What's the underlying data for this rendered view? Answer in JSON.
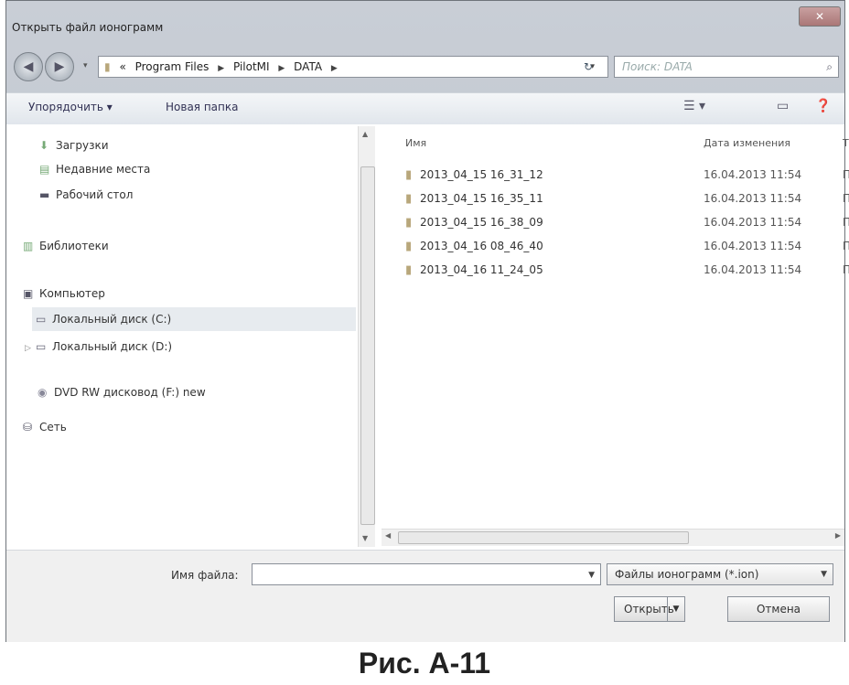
{
  "window": {
    "title": "Открыть файл ионограмм",
    "close_label": "✕"
  },
  "address": {
    "back_icon": "back-arrow-icon",
    "forward_icon": "forward-arrow-icon",
    "prefix": "«",
    "crumbs": [
      "Program Files",
      "PilotMI",
      "DATA"
    ],
    "search_placeholder": "Поиск: DATA"
  },
  "toolbar": {
    "organize_label": "Упорядочить ▾",
    "new_folder_label": "Новая папка",
    "view_icon": "view-options-icon",
    "preview_icon": "preview-pane-icon",
    "help_icon": "help-icon"
  },
  "nav": {
    "items": [
      {
        "label": "Загрузки",
        "icon": "downloads-icon"
      },
      {
        "label": "Недавние места",
        "icon": "recent-places-icon"
      },
      {
        "label": "Рабочий стол",
        "icon": "desktop-icon"
      },
      {
        "label": "Библиотеки",
        "icon": "libraries-icon"
      },
      {
        "label": "Компьютер",
        "icon": "computer-icon"
      },
      {
        "label": "Локальный диск (C:)",
        "icon": "drive-icon",
        "selected": true
      },
      {
        "label": "Локальный диск (D:)",
        "icon": "drive-icon"
      },
      {
        "label": "DVD RW дисковод (F:) new",
        "icon": "dvd-icon"
      },
      {
        "label": "Сеть",
        "icon": "network-icon"
      }
    ]
  },
  "files": {
    "columns": [
      "Имя",
      "Дата изменения",
      "Т"
    ],
    "rows": [
      {
        "name": "2013_04_15 16_31_12",
        "date": "16.04.2013 11:54",
        "extra": "П"
      },
      {
        "name": "2013_04_15 16_35_11",
        "date": "16.04.2013 11:54",
        "extra": "П"
      },
      {
        "name": "2013_04_15 16_38_09",
        "date": "16.04.2013 11:54",
        "extra": "П"
      },
      {
        "name": "2013_04_16 08_46_40",
        "date": "16.04.2013 11:54",
        "extra": "П"
      },
      {
        "name": "2013_04_16 11_24_05",
        "date": "16.04.2013 11:54",
        "extra": "П"
      }
    ]
  },
  "bottom": {
    "filename_label": "Имя файла:",
    "filename_value": "",
    "filter_label": "Файлы ионограмм (*.ion)",
    "open_label": "Открыть",
    "cancel_label": "Отмена"
  },
  "caption": "Рис. А-11"
}
